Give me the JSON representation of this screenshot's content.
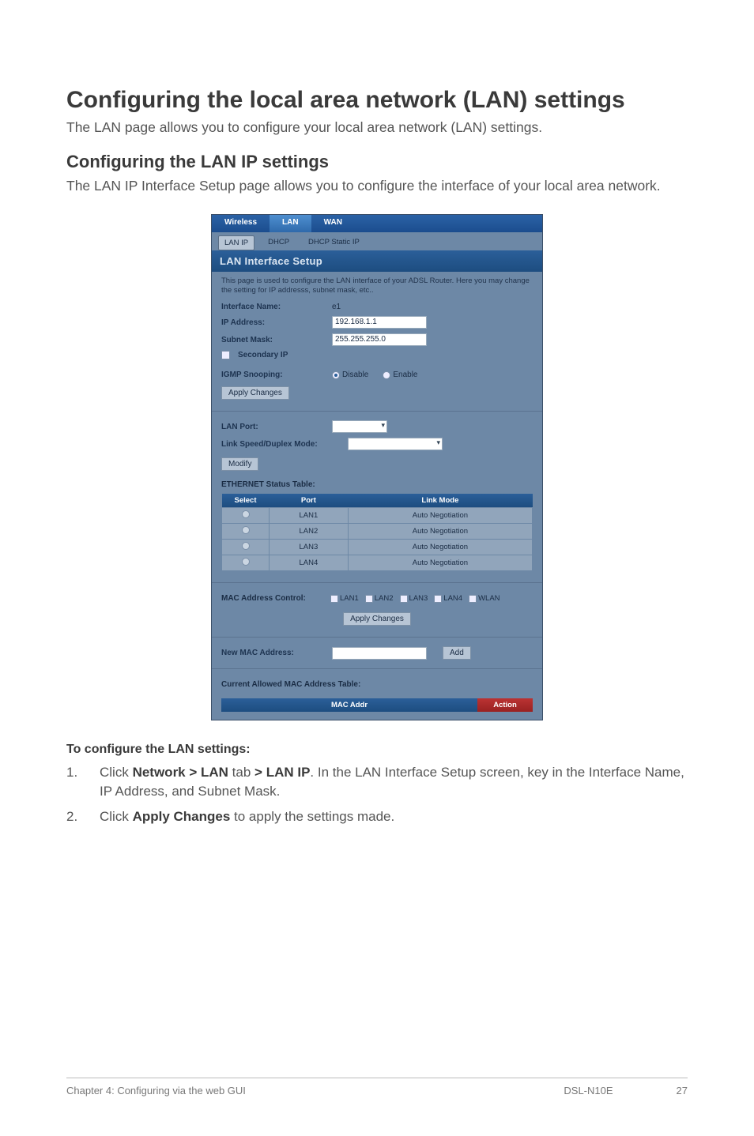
{
  "h1": "Configuring the local area network (LAN) settings",
  "intro": "The LAN page allows you to configure your local area network (LAN) settings.",
  "h2": "Configuring the LAN IP settings",
  "sub": "The LAN IP Interface Setup page allows you to configure the interface of your local area network.",
  "router": {
    "tabs_top": {
      "wireless": "Wireless",
      "lan": "LAN",
      "wan": "WAN"
    },
    "tabs_sub": {
      "lanip": "LAN IP",
      "dhcp": "DHCP",
      "dhcpstatic": "DHCP Static IP"
    },
    "title": "LAN Interface Setup",
    "desc": "This page is used to configure the LAN interface of your ADSL Router. Here you may change the setting for IP addresss, subnet mask, etc..",
    "iface_label": "Interface Name:",
    "iface_val": "e1",
    "ip_label": "IP Address:",
    "ip_val": "192.168.1.1",
    "mask_label": "Subnet Mask:",
    "mask_val": "255.255.255.0",
    "secip_label": "Secondary IP",
    "igmp_label": "IGMP Snooping:",
    "igmp_disable": "Disable",
    "igmp_enable": "Enable",
    "apply_btn": "Apply Changes",
    "lanport_label": "LAN Port:",
    "linkspeed_label": "Link Speed/Duplex Mode:",
    "modify_btn": "Modify",
    "eth_table_title": "ETHERNET Status Table:",
    "eth_headers": [
      "Select",
      "Port",
      "Link Mode"
    ],
    "eth_rows": [
      {
        "port": "LAN1",
        "mode": "Auto Negotiation"
      },
      {
        "port": "LAN2",
        "mode": "Auto Negotiation"
      },
      {
        "port": "LAN3",
        "mode": "Auto Negotiation"
      },
      {
        "port": "LAN4",
        "mode": "Auto Negotiation"
      }
    ],
    "mac_ctrl_label": "MAC Address Control:",
    "mac_opts": [
      "LAN1",
      "LAN2",
      "LAN3",
      "LAN4",
      "WLAN"
    ],
    "newmac_label": "New MAC Address:",
    "add_btn": "Add",
    "allowed_title": "Current Allowed MAC Address Table:",
    "allowed_headers": {
      "mac": "MAC Addr",
      "action": "Action"
    }
  },
  "proc_h": "To configure the LAN settings:",
  "steps": [
    {
      "n": "1.",
      "pre": "Click ",
      "b1": "Network > LAN",
      "mid1": " tab ",
      "b2": "> LAN IP",
      "post1": ". In the LAN Interface Setup screen, key in the Interface Name, IP Address, and Subnet Mask."
    },
    {
      "n": "2.",
      "pre": "Click ",
      "b1": "Apply Changes",
      "post1": " to apply the settings made."
    }
  ],
  "footer": {
    "left": "Chapter 4: Configuring via the web GUI",
    "model": "DSL-N10E",
    "page": "27"
  }
}
